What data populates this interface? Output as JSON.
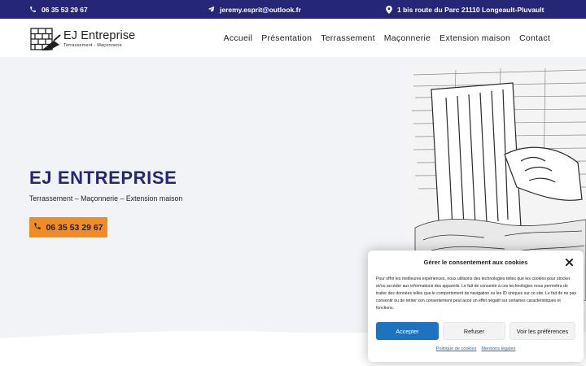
{
  "colors": {
    "topbar_bg": "#262676",
    "accent": "#f08c22",
    "title": "#262676",
    "primary_button": "#1e73be",
    "hero_bg": "#f2f3f6"
  },
  "topbar": {
    "phone": "06 35 53 29 67",
    "phone_icon": "phone-icon",
    "email": "jeremy.esprit@outlook.fr",
    "email_icon": "paper-plane-icon",
    "address": "1 bis route du Parc 21110 Longeault-Pluvault",
    "address_icon": "map-pin-icon"
  },
  "header": {
    "logo_icon": "brick-wall-trowel-logo",
    "logo_title": "EJ Entreprise",
    "logo_subtitle": "Terrassement - Maçonnerie",
    "nav": [
      "Accueil",
      "Présentation",
      "Terrassement",
      "Maçonnerie",
      "Extension maison",
      "Contact"
    ]
  },
  "hero": {
    "title": "EJ ENTREPRISE",
    "subtitle": "Terrassement – Maçonnerie – Extension maison",
    "cta_phone": "06 35 53 29 67",
    "cta_icon": "phone-icon",
    "image": "sketch-of-hands-laying-bricks"
  },
  "cookie_banner": {
    "title": "Gérer le consentement aux cookies",
    "close_icon": "close-icon",
    "text": "Pour offrir les meilleures expériences, nous utilisons des technologies telles que les cookies pour stocker et/ou accéder aux informations des appareils. Le fait de consentir à ces technologies nous permettra de traiter des données telles que le comportement de navigation ou les ID uniques sur ce site. Le fait de ne pas consentir ou de retirer son consentement peut avoir un effet négatif sur certaines caractéristiques et fonctions.",
    "accept_label": "Accepter",
    "refuse_label": "Refuser",
    "preferences_label": "Voir les préférences",
    "cookie_policy_link": "Politique de cookies",
    "legal_link": "Mentions légales"
  }
}
